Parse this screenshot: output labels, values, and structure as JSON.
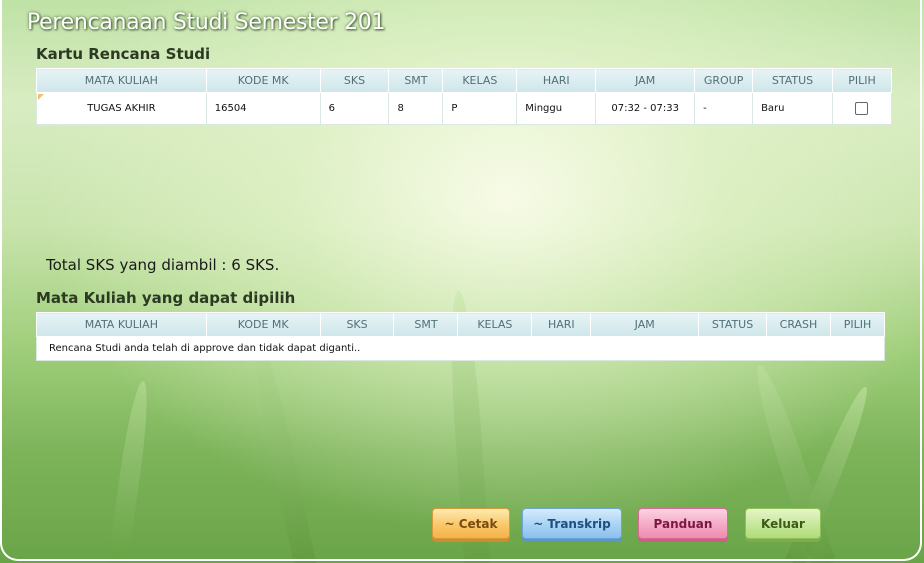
{
  "page": {
    "title": "Perencanaan Studi Semester 201"
  },
  "krs": {
    "title": "Kartu Rencana Studi",
    "columns": [
      "MATA KULIAH",
      "KODE MK",
      "SKS",
      "SMT",
      "KELAS",
      "HARI",
      "JAM",
      "GROUP",
      "STATUS",
      "PILIH"
    ],
    "rows": [
      {
        "mata_kuliah": "TUGAS AKHIR",
        "kode_mk": "16504",
        "sks": "6",
        "smt": "8",
        "kelas": "P",
        "hari": "Minggu",
        "jam": "07:32 - 07:33",
        "group": "-",
        "status": "Baru",
        "pilih": false
      }
    ]
  },
  "total": {
    "text": "Total SKS yang diambil : 6 SKS."
  },
  "available": {
    "title": "Mata Kuliah yang dapat dipilih",
    "columns": [
      "MATA KULIAH",
      "KODE MK",
      "SKS",
      "SMT",
      "KELAS",
      "HARI",
      "JAM",
      "STATUS",
      "CRASH",
      "PILIH"
    ],
    "message": "Rencana Studi anda telah di approve dan tidak dapat diganti.."
  },
  "buttons": {
    "cetak": "~ Cetak",
    "transkrip": "~ Transkrip",
    "panduan": "Panduan",
    "keluar": "Keluar"
  },
  "colors": {
    "header_bg": "#cfe6ea",
    "header_text": "#51707a",
    "cetak": "#f9c86a",
    "transkrip": "#a9d3f4",
    "panduan": "#f5a9c5",
    "keluar": "#c6e79a"
  }
}
